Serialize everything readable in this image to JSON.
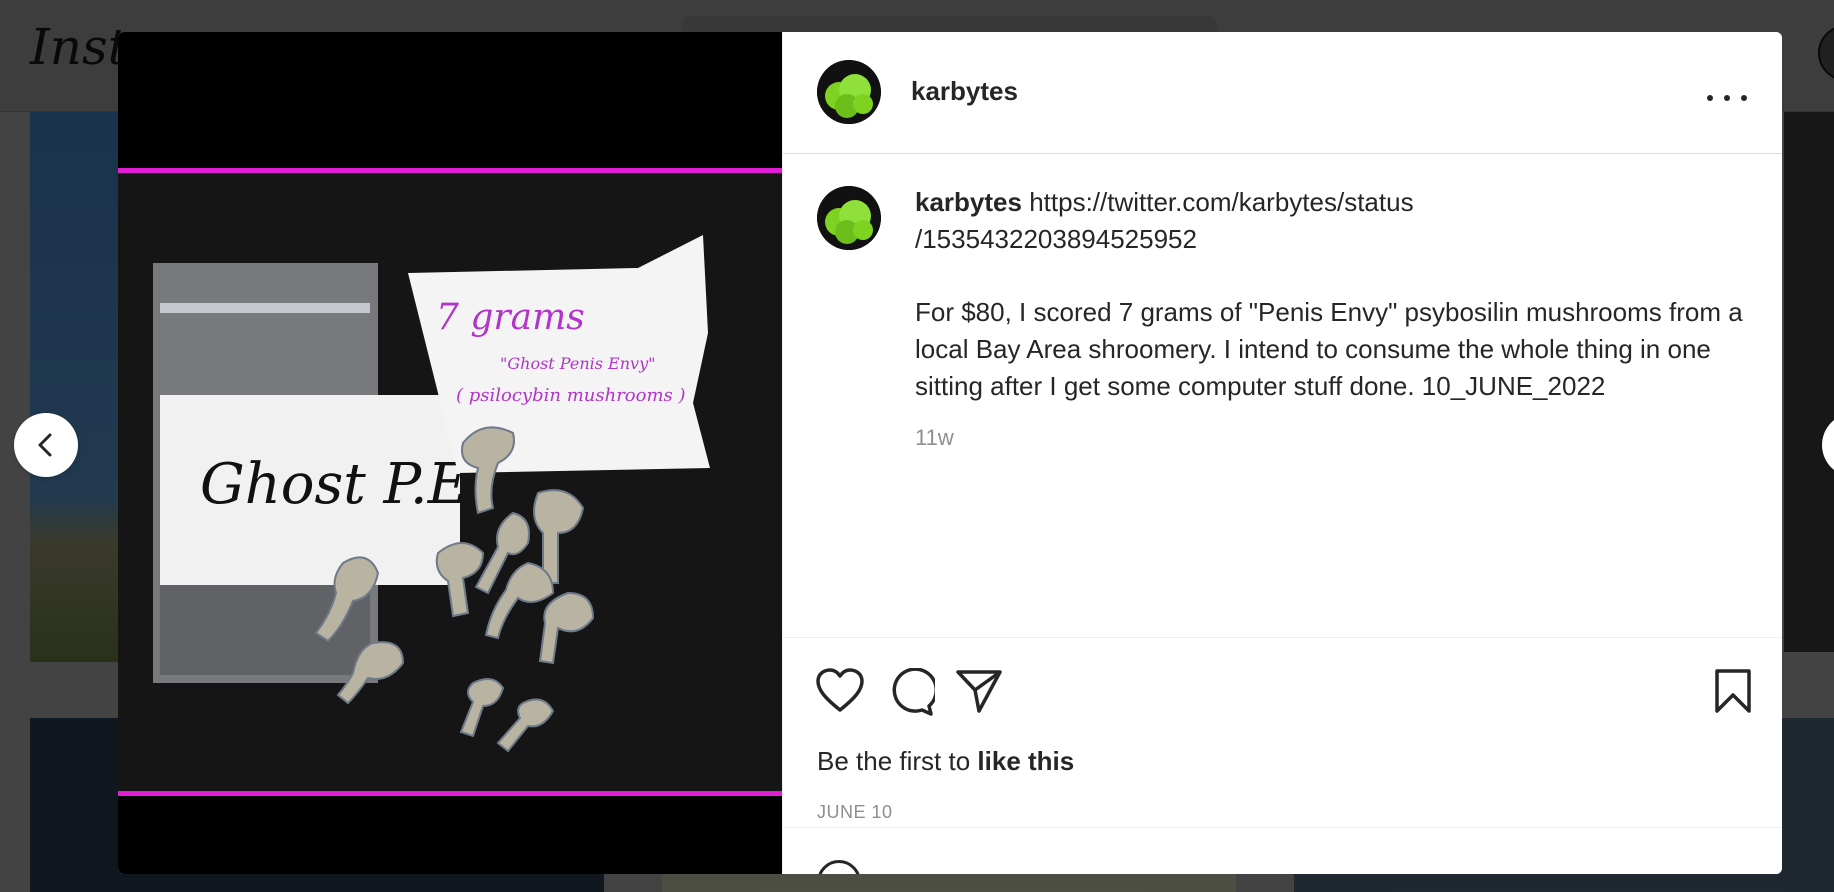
{
  "app": {
    "logo_text": "Instagram"
  },
  "post": {
    "author": "karbytes",
    "caption": {
      "author": "karbytes",
      "link_line1": "https://twitter.com/karbytes/status",
      "link_line2": "/1535432203894525952",
      "body": "For $80, I scored 7 grams of \"Penis Envy\" psybosilin mushrooms from a local Bay Area shroomery. I intend to consume the whole thing in one sitting after I get some computer stuff done. 10_JUNE_2022",
      "time_ago": "11w"
    },
    "likes_prefix": "Be the first to ",
    "likes_bold": "like this",
    "date": "JUNE 10"
  },
  "image": {
    "note_title": "7 grams",
    "note_subtitle": "\"Ghost Penis Envy\"",
    "note_detail": "( psilocybin mushrooms )",
    "bag_label": "Ghost P.E."
  },
  "icons": {
    "like": "heart-icon",
    "comment": "comment-icon",
    "share": "paper-plane-icon",
    "save": "bookmark-icon",
    "more": "more-options-icon",
    "prev": "chevron-left-icon",
    "next": "chevron-right-icon"
  },
  "colors": {
    "frame_accent": "#e01cd5",
    "avatar_green": "#7ed321",
    "text": "#262626",
    "muted": "#8e8e8e"
  }
}
